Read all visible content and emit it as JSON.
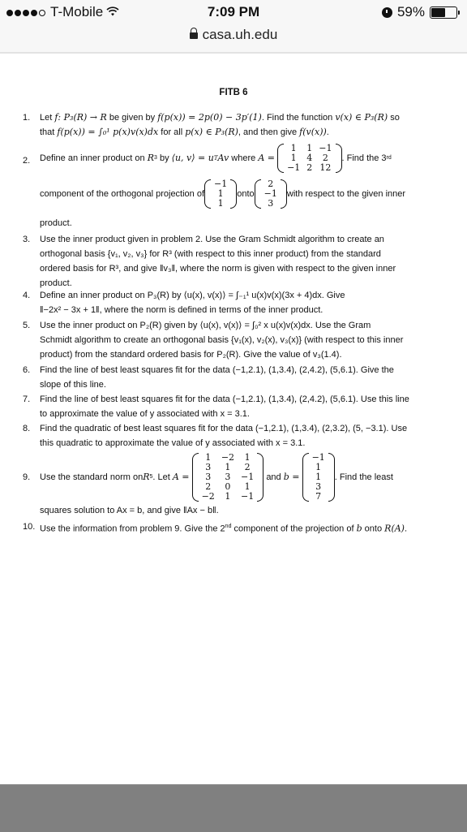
{
  "status_bar": {
    "signal_dots_filled": 4,
    "signal_dots_total": 5,
    "carrier": "T-Mobile",
    "time": "7:09 PM",
    "battery_percent_label": "59%",
    "battery_level": 0.59
  },
  "browser": {
    "url": "casa.uh.edu"
  },
  "document": {
    "title": "FITB 6",
    "problems": [
      {
        "num": "1.",
        "line1_a": "Let ",
        "line1_math1": "f: P₃(R) → R",
        "line1_b": " be given by ",
        "line1_math2": "f(p(x)) = 2p(0) − 3p′(1)",
        "line1_c": ". Find the function ",
        "line1_math3": "v(x) ∈ P₃(R)",
        "line1_d": " so",
        "line2_a": "that ",
        "line2_math1": "f(p(x)) = ∫₀¹ p(x)v(x)dx",
        "line2_b": " for all ",
        "line2_math2": "p(x) ∈ P₃(R)",
        "line2_c": ", and then give ",
        "line2_math3": "f(v(x))",
        "line2_d": "."
      },
      {
        "num": "2.",
        "text_a": "Define an inner product on ",
        "math_a": "R",
        "sup_a": "3",
        "text_b": " by ",
        "math_b": "⟨u, v⟩ = u",
        "sup_b": "T",
        "math_c": "Av",
        "text_c": " where ",
        "math_d": "A =",
        "matrix_A": [
          [
            "1",
            "1",
            "−1"
          ],
          [
            "1",
            "4",
            "2"
          ],
          [
            "−1",
            "2",
            "12"
          ]
        ],
        "text_d": ". Find the 3",
        "sup_d": "rd",
        "text_e": "component of the orthogonal projection of ",
        "vector_1": [
          "−1",
          "1",
          "1"
        ],
        "text_f": " onto ",
        "vector_2": [
          "2",
          "−1",
          "3"
        ],
        "text_g": " with respect to the given inner",
        "text_h": "product."
      },
      {
        "num": "3.",
        "lines": [
          "Use the inner product given in problem 2. Use the Gram Schmidt algorithm to create an",
          "orthogonal basis {v₁, v₂, v₃} for R³ (with respect to this inner product) from the standard",
          "ordered basis for R³, and give ‖v₃‖, where the norm is given with respect to the given inner",
          "product."
        ]
      },
      {
        "num": "4.",
        "lines": [
          "Define an inner product on P₃(R) by ⟨u(x), v(x)⟩ = ∫₋₁¹ u(x)v(x)(3x + 4)dx. Give",
          "‖−2x² − 3x + 1‖, where the norm is defined in terms of the inner product."
        ]
      },
      {
        "num": "5.",
        "lines": [
          "Use the inner product on P₂(R) given by ⟨u(x), v(x)⟩ = ∫₀² x u(x)v(x)dx. Use the Gram",
          "Schmidt algorithm to create an orthogonal basis {v₁(x), v₂(x), v₃(x)} (with respect to this inner",
          "product) from the standard ordered basis for P₂(R). Give the value of v₃(1.4)."
        ]
      },
      {
        "num": "6.",
        "lines": [
          "Find the line of best least squares fit for the data (−1,2.1), (1,3.4), (2,4.2), (5,6.1). Give the",
          "slope of this line."
        ]
      },
      {
        "num": "7.",
        "lines": [
          "Find the line of best least squares fit for the data (−1,2.1), (1,3.4), (2,4.2), (5,6.1). Use this line",
          "to approximate the value of y associated with x = 3.1."
        ]
      },
      {
        "num": "8.",
        "lines": [
          "Find the quadratic of best least squares fit for the data (−1,2.1), (1,3.4), (2,3.2), (5, −3.1). Use",
          "this quadratic to approximate the value of y associated with x = 3.1."
        ]
      },
      {
        "num": "9.",
        "text_a": "Use the standard norm on ",
        "math_a": "R",
        "sup_a": "5",
        "text_b": ". Let ",
        "math_b": "A =",
        "matrix_A": [
          [
            "1",
            "−2",
            "1"
          ],
          [
            "3",
            "1",
            "2"
          ],
          [
            "3",
            "3",
            "−1"
          ],
          [
            "2",
            "0",
            "1"
          ],
          [
            "−2",
            "1",
            "−1"
          ]
        ],
        "text_c": " and ",
        "math_c": "b =",
        "vector_b": [
          "−1",
          "1",
          "1",
          "3",
          "7"
        ],
        "text_d": ". Find the least",
        "line2": "squares solution to Ax = b, and give ‖Ax − b‖."
      },
      {
        "num": "10.",
        "text_a": "Use the information from problem 9. Give the 2",
        "sup_a": "nd",
        "text_b": " component of the projection of ",
        "math_a": "b",
        "text_c": " onto ",
        "math_b": "R(A)",
        "text_d": "."
      }
    ]
  }
}
